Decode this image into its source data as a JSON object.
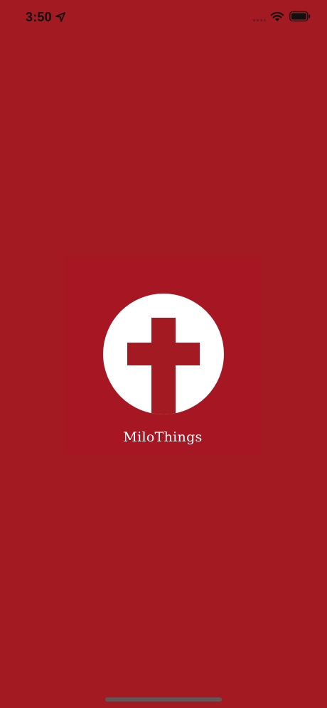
{
  "status_bar": {
    "time": "3:50",
    "icons": [
      "location-arrow-icon",
      "cellular-signal-icon",
      "wifi-icon",
      "battery-icon"
    ]
  },
  "splash": {
    "brand_name": "MiloThings",
    "logo": "cross-in-circle-icon"
  },
  "colors": {
    "background": "#a41a22",
    "card": "#a61623",
    "logo_circle": "#ffffff",
    "text": "#ffffff",
    "status_text": "#111111"
  }
}
